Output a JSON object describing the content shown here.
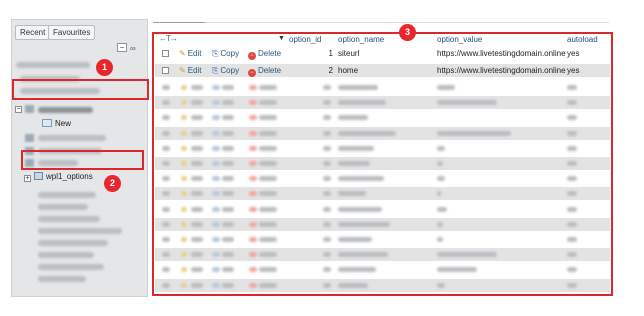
{
  "navigation": {
    "tabs": [
      "Recent",
      "Favourites"
    ],
    "collapse_glyph": "−",
    "link_glyph": "∞",
    "database": {
      "name": "████_██_█████",
      "tree_mark": "−"
    },
    "new_label": "New",
    "table": {
      "name": "wpl1_options",
      "tree_mark": "+"
    }
  },
  "badges": [
    "1",
    "2",
    "3"
  ],
  "grid": {
    "arrows": "←T→",
    "sort_arrow": "▼",
    "columns": {
      "id": "option_id",
      "name": "option_name",
      "value": "option_value",
      "autoload": "autoload"
    },
    "action_labels": {
      "edit": "Edit",
      "copy": "Copy",
      "delete": "Delete"
    },
    "rows": [
      {
        "id": "1",
        "name": "siteurl",
        "value": "https://www.livetestingdomain.online",
        "autoload": "yes"
      },
      {
        "id": "2",
        "name": "home",
        "value": "https://www.livetestingdomain.online",
        "autoload": "yes"
      }
    ],
    "blurred_row_count": 14
  },
  "colors": {
    "highlight": "#d9282e",
    "badge": "#e8262c",
    "link": "#23527c",
    "row_alt": "#e3e3e3"
  }
}
